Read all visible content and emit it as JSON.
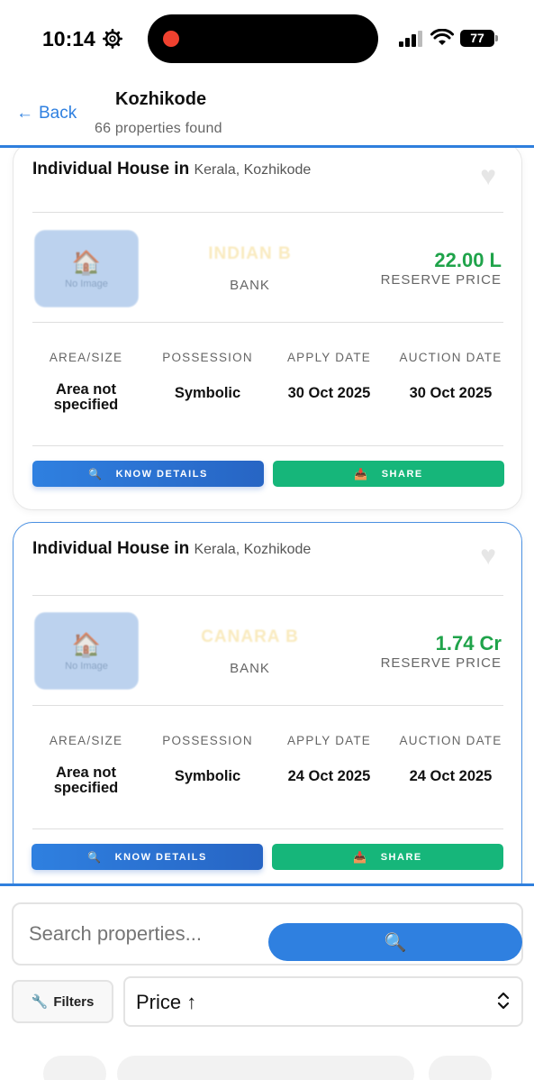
{
  "status_bar": {
    "time": "10:14",
    "battery": "77"
  },
  "header": {
    "back_label": "Back",
    "title": "Kozhikode",
    "subtitle": "66 properties found"
  },
  "cards": [
    {
      "type": "Individual House in",
      "location": "Kerala, Kozhikode",
      "thumb_text": "No Image",
      "bank_name": "INDIAN B",
      "bank_label": "BANK",
      "price": "22.00 L",
      "price_label": "RESERVE PRICE",
      "stats": [
        {
          "head": "AREA/SIZE",
          "value": "Area not specified"
        },
        {
          "head": "POSSESSION",
          "value": "Symbolic"
        },
        {
          "head": "APPLY DATE",
          "value": "30 Oct 2025"
        },
        {
          "head": "AUCTION DATE",
          "value": "30 Oct 2025"
        }
      ],
      "know_details_label": "KNOW DETAILS",
      "share_label": "SHARE"
    },
    {
      "type": "Individual House in",
      "location": "Kerala, Kozhikode",
      "thumb_text": "No Image",
      "bank_name": "CANARA B",
      "bank_label": "BANK",
      "price": "1.74 Cr",
      "price_label": "RESERVE PRICE",
      "stats": [
        {
          "head": "AREA/SIZE",
          "value": "Area not specified"
        },
        {
          "head": "POSSESSION",
          "value": "Symbolic"
        },
        {
          "head": "APPLY DATE",
          "value": "24 Oct 2025"
        },
        {
          "head": "AUCTION DATE",
          "value": "24 Oct 2025"
        }
      ],
      "know_details_label": "KNOW DETAILS",
      "share_label": "SHARE"
    }
  ],
  "search": {
    "placeholder": "Search properties...",
    "filters_label": "Filters",
    "sort_value": "Price ↑"
  },
  "colors": {
    "accent": "#2f80e0",
    "price_green": "#1fa34a",
    "share_green": "#16b67a"
  },
  "icons": {
    "back": "arrow-left-icon",
    "favorite": "heart-icon",
    "search": "magnifier-icon",
    "share": "inbox-tray-icon",
    "filters": "wrench-icon",
    "sort": "chevron-updown-icon"
  }
}
